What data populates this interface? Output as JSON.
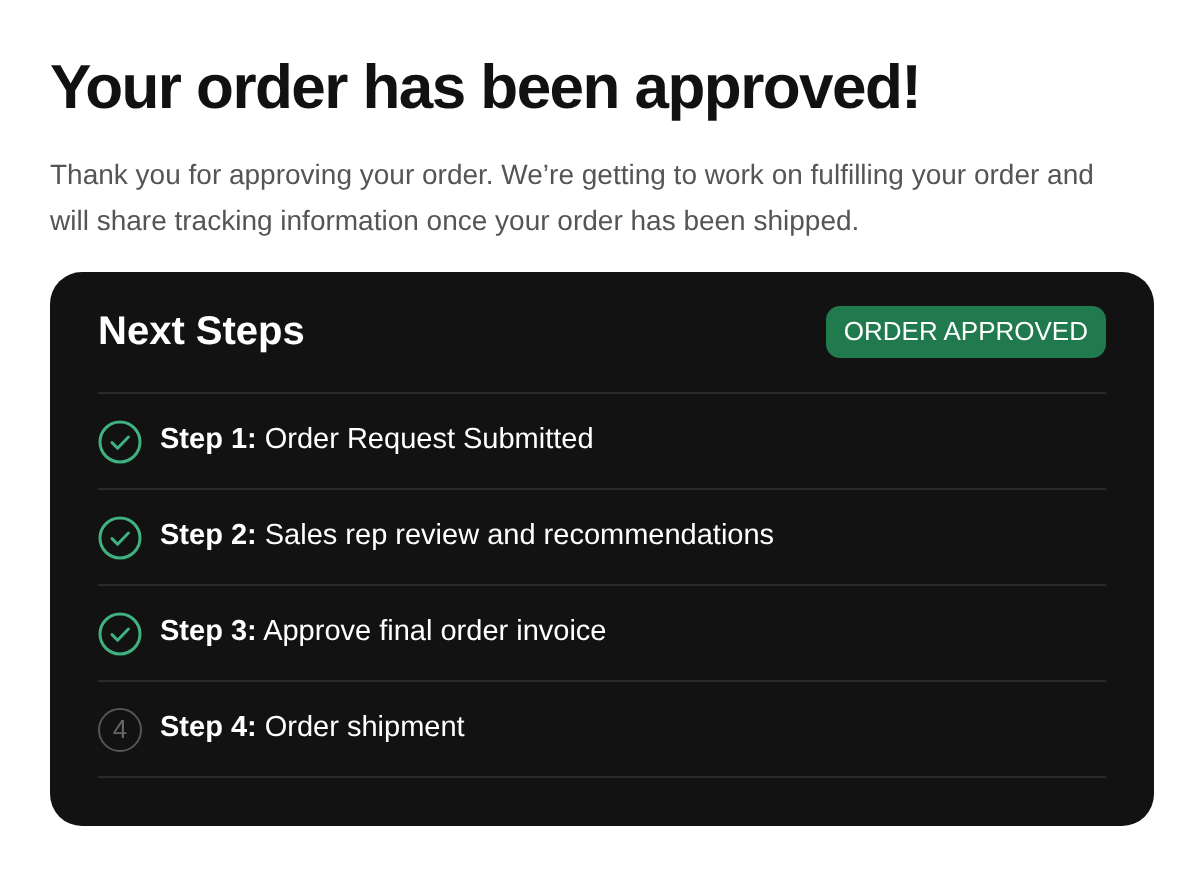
{
  "heading": "Your order has been approved!",
  "message": "Thank you for approving your order. We’re getting to work on fulfilling your order and will share tracking information once your order has been shipped.",
  "card": {
    "title": "Next Steps",
    "badge": "ORDER APPROVED",
    "steps": [
      {
        "text": "**Step 1:** Order Request Submitted",
        "done": true
      },
      {
        "text": "**Step 2:** Sales rep review and recommendations",
        "done": true
      },
      {
        "text": "**Step 3:** Approve final order invoice",
        "done": true
      },
      {
        "text": "**Step 4:** Order shipment",
        "done": false,
        "marker": "4"
      }
    ]
  }
}
